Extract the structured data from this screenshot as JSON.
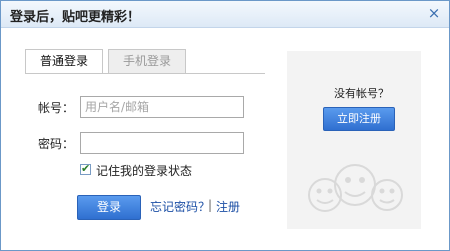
{
  "dialog": {
    "title": "登录后，贴吧更精彩！",
    "close_icon": "×"
  },
  "tabs": [
    {
      "label": "普通登录",
      "active": true
    },
    {
      "label": "手机登录",
      "active": false
    }
  ],
  "form": {
    "account_label": "帐号：",
    "account_placeholder": "用户名/邮箱",
    "account_value": "",
    "password_label": "密码：",
    "password_value": "",
    "remember_label": "记住我的登录状态",
    "remember_checked": true,
    "login_button": "登录",
    "forgot_link": "忘记密码？",
    "separator": "|",
    "register_link": "注册"
  },
  "sidebar": {
    "no_account_text": "没有帐号？",
    "register_button": "立即注册"
  },
  "colors": {
    "accent": "#2f6fd0",
    "link": "#1c4fa5",
    "titlebar": "#dde9f6",
    "panel": "#f3f3f3"
  }
}
